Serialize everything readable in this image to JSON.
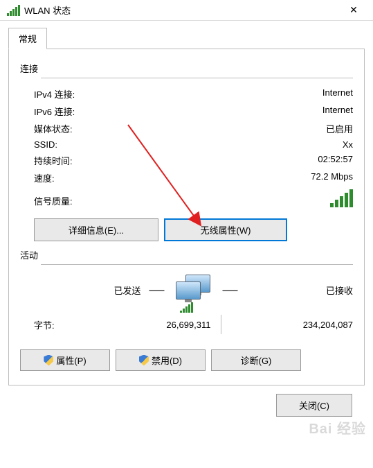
{
  "window": {
    "title": "WLAN 状态"
  },
  "tab": {
    "general": "常规"
  },
  "connection": {
    "header": "连接",
    "ipv4_label": "IPv4 连接:",
    "ipv4_value": "Internet",
    "ipv6_label": "IPv6 连接:",
    "ipv6_value": "Internet",
    "media_label": "媒体状态:",
    "media_value": "已启用",
    "ssid_label": "SSID:",
    "ssid_value": "Xx",
    "duration_label": "持续时间:",
    "duration_value": "02:52:57",
    "speed_label": "速度:",
    "speed_value": "72.2 Mbps",
    "signal_label": "信号质量:"
  },
  "buttons": {
    "details": "详细信息(E)...",
    "wireless_props": "无线属性(W)",
    "properties": "属性(P)",
    "disable": "禁用(D)",
    "diagnose": "诊断(G)",
    "close": "关闭(C)"
  },
  "activity": {
    "header": "活动",
    "sent_label": "已发送",
    "recv_label": "已接收",
    "bytes_label": "字节:",
    "sent_value": "26,699,311",
    "recv_value": "234,204,087"
  },
  "watermark": "Bai 经验"
}
